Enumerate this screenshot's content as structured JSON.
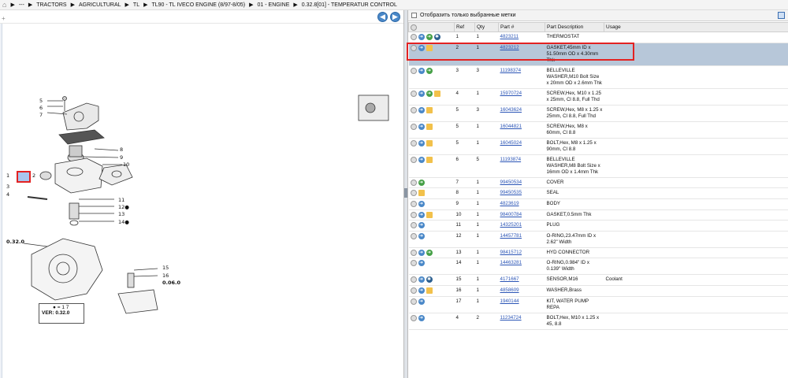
{
  "breadcrumb": {
    "home_icon": "home-icon",
    "items": [
      "---",
      "TRACTORS",
      "AGRICULTURAL",
      "TL",
      "TL90 - TL IVECO ENGINE (8/97-8/05)",
      "01 - ENGINE",
      "0.32.8[01] - TEMPERATUR CONTROL"
    ]
  },
  "diagram": {
    "callouts": [
      "5",
      "6",
      "7",
      "8",
      "9",
      "10",
      "1",
      "2",
      "3",
      "4",
      "11",
      "12●",
      "13",
      "14●",
      "15",
      "16",
      "0.32.0",
      "0.06.0"
    ],
    "ver_symbol": "● = 1 7",
    "ver_text": "VER: 0.32.0"
  },
  "filter": {
    "label": "Отобразить только выбранные метки"
  },
  "table": {
    "columns": [
      "Ref",
      "Qty",
      "Part #",
      "Part Description",
      "Usage"
    ],
    "rows": [
      {
        "icons": [
          "circle",
          "blue",
          "green",
          "gear"
        ],
        "ref": "1",
        "qty": "1",
        "part": "4823211",
        "desc": "THERMOSTAT",
        "usage": ""
      },
      {
        "icons": [
          "circle",
          "blue",
          "box"
        ],
        "ref": "2",
        "qty": "1",
        "part": "4823212",
        "desc": "GASKET,45mm ID x 51.50mm OD x 4.30mm Thk",
        "usage": "",
        "selected": true
      },
      {
        "icons": [
          "circle",
          "blue",
          "green"
        ],
        "ref": "3",
        "qty": "3",
        "part": "11198374",
        "desc": "BELLEVILLE WASHER,M10 Bolt Size x 20mm OD x 2.6mm Thk",
        "usage": ""
      },
      {
        "icons": [
          "circle",
          "blue",
          "green",
          "box"
        ],
        "ref": "4",
        "qty": "1",
        "part": "15970724",
        "desc": "SCREW,Hex, M10 x 1.25 x 25mm, Cl 8.8, Full Thd",
        "usage": ""
      },
      {
        "icons": [
          "circle",
          "blue",
          "box"
        ],
        "ref": "5",
        "qty": "3",
        "part": "16043624",
        "desc": "SCREW,Hex, M8 x 1.25 x 25mm, Cl 8.8, Full Thd",
        "usage": ""
      },
      {
        "icons": [
          "circle",
          "blue",
          "box"
        ],
        "ref": "5",
        "qty": "1",
        "part": "16044821",
        "desc": "SCREW,Hex, M8 x 60mm, Cl 8.8",
        "usage": ""
      },
      {
        "icons": [
          "circle",
          "blue",
          "box"
        ],
        "ref": "5",
        "qty": "1",
        "part": "16045024",
        "desc": "BOLT,Hex, M8 x 1.25 x 90mm, Cl 8.8",
        "usage": ""
      },
      {
        "icons": [
          "circle",
          "blue",
          "box"
        ],
        "ref": "6",
        "qty": "5",
        "part": "11193874",
        "desc": "BELLEVILLE WASHER,M8 Bolt Size x 16mm OD x 1.4mm Thk",
        "usage": ""
      },
      {
        "icons": [
          "circle",
          "green"
        ],
        "ref": "7",
        "qty": "1",
        "part": "99450534",
        "desc": "COVER",
        "usage": ""
      },
      {
        "icons": [
          "circle",
          "box"
        ],
        "ref": "8",
        "qty": "1",
        "part": "99450535",
        "desc": "SEAL",
        "usage": ""
      },
      {
        "icons": [
          "circle",
          "blue"
        ],
        "ref": "9",
        "qty": "1",
        "part": "4823619",
        "desc": "BODY",
        "usage": ""
      },
      {
        "icons": [
          "circle",
          "blue",
          "box"
        ],
        "ref": "10",
        "qty": "1",
        "part": "98400784",
        "desc": "GASKET,0.5mm Thk",
        "usage": ""
      },
      {
        "icons": [
          "circle",
          "blue"
        ],
        "ref": "11",
        "qty": "1",
        "part": "14325201",
        "desc": "PLUG",
        "usage": ""
      },
      {
        "icons": [
          "circle",
          "blue"
        ],
        "ref": "12",
        "qty": "1",
        "part": "14457781",
        "desc": "O-RING,23.47mm ID x 2.62\" Width",
        "usage": ""
      },
      {
        "icons": [
          "circle",
          "blue",
          "green"
        ],
        "ref": "13",
        "qty": "1",
        "part": "98415712",
        "desc": "HYD CONNECTOR",
        "usage": ""
      },
      {
        "icons": [
          "circle",
          "blue"
        ],
        "ref": "14",
        "qty": "1",
        "part": "14463281",
        "desc": "O-RING,0.984\" ID x 0.139\" Width",
        "usage": ""
      },
      {
        "icons": [
          "circle",
          "blue",
          "gear"
        ],
        "ref": "15",
        "qty": "1",
        "part": "4171667",
        "desc": "SENSOR,M16",
        "usage": "Coolant"
      },
      {
        "icons": [
          "circle",
          "blue",
          "box"
        ],
        "ref": "16",
        "qty": "1",
        "part": "4858609",
        "desc": "WASHER,Brass",
        "usage": ""
      },
      {
        "icons": [
          "circle",
          "blue"
        ],
        "ref": "17",
        "qty": "1",
        "part": "1940144",
        "desc": "KIT, WATER PUMP REPA",
        "usage": ""
      },
      {
        "icons": [
          "circle",
          "blue"
        ],
        "ref": "4",
        "qty": "2",
        "part": "11234724",
        "desc": "BOLT,Hex, M10 x 1.25 x 45, 8.8",
        "usage": ""
      }
    ]
  },
  "colors": {
    "selected_row": "#b7c7d9",
    "highlight": "#e32222",
    "link": "#2b55b6"
  }
}
